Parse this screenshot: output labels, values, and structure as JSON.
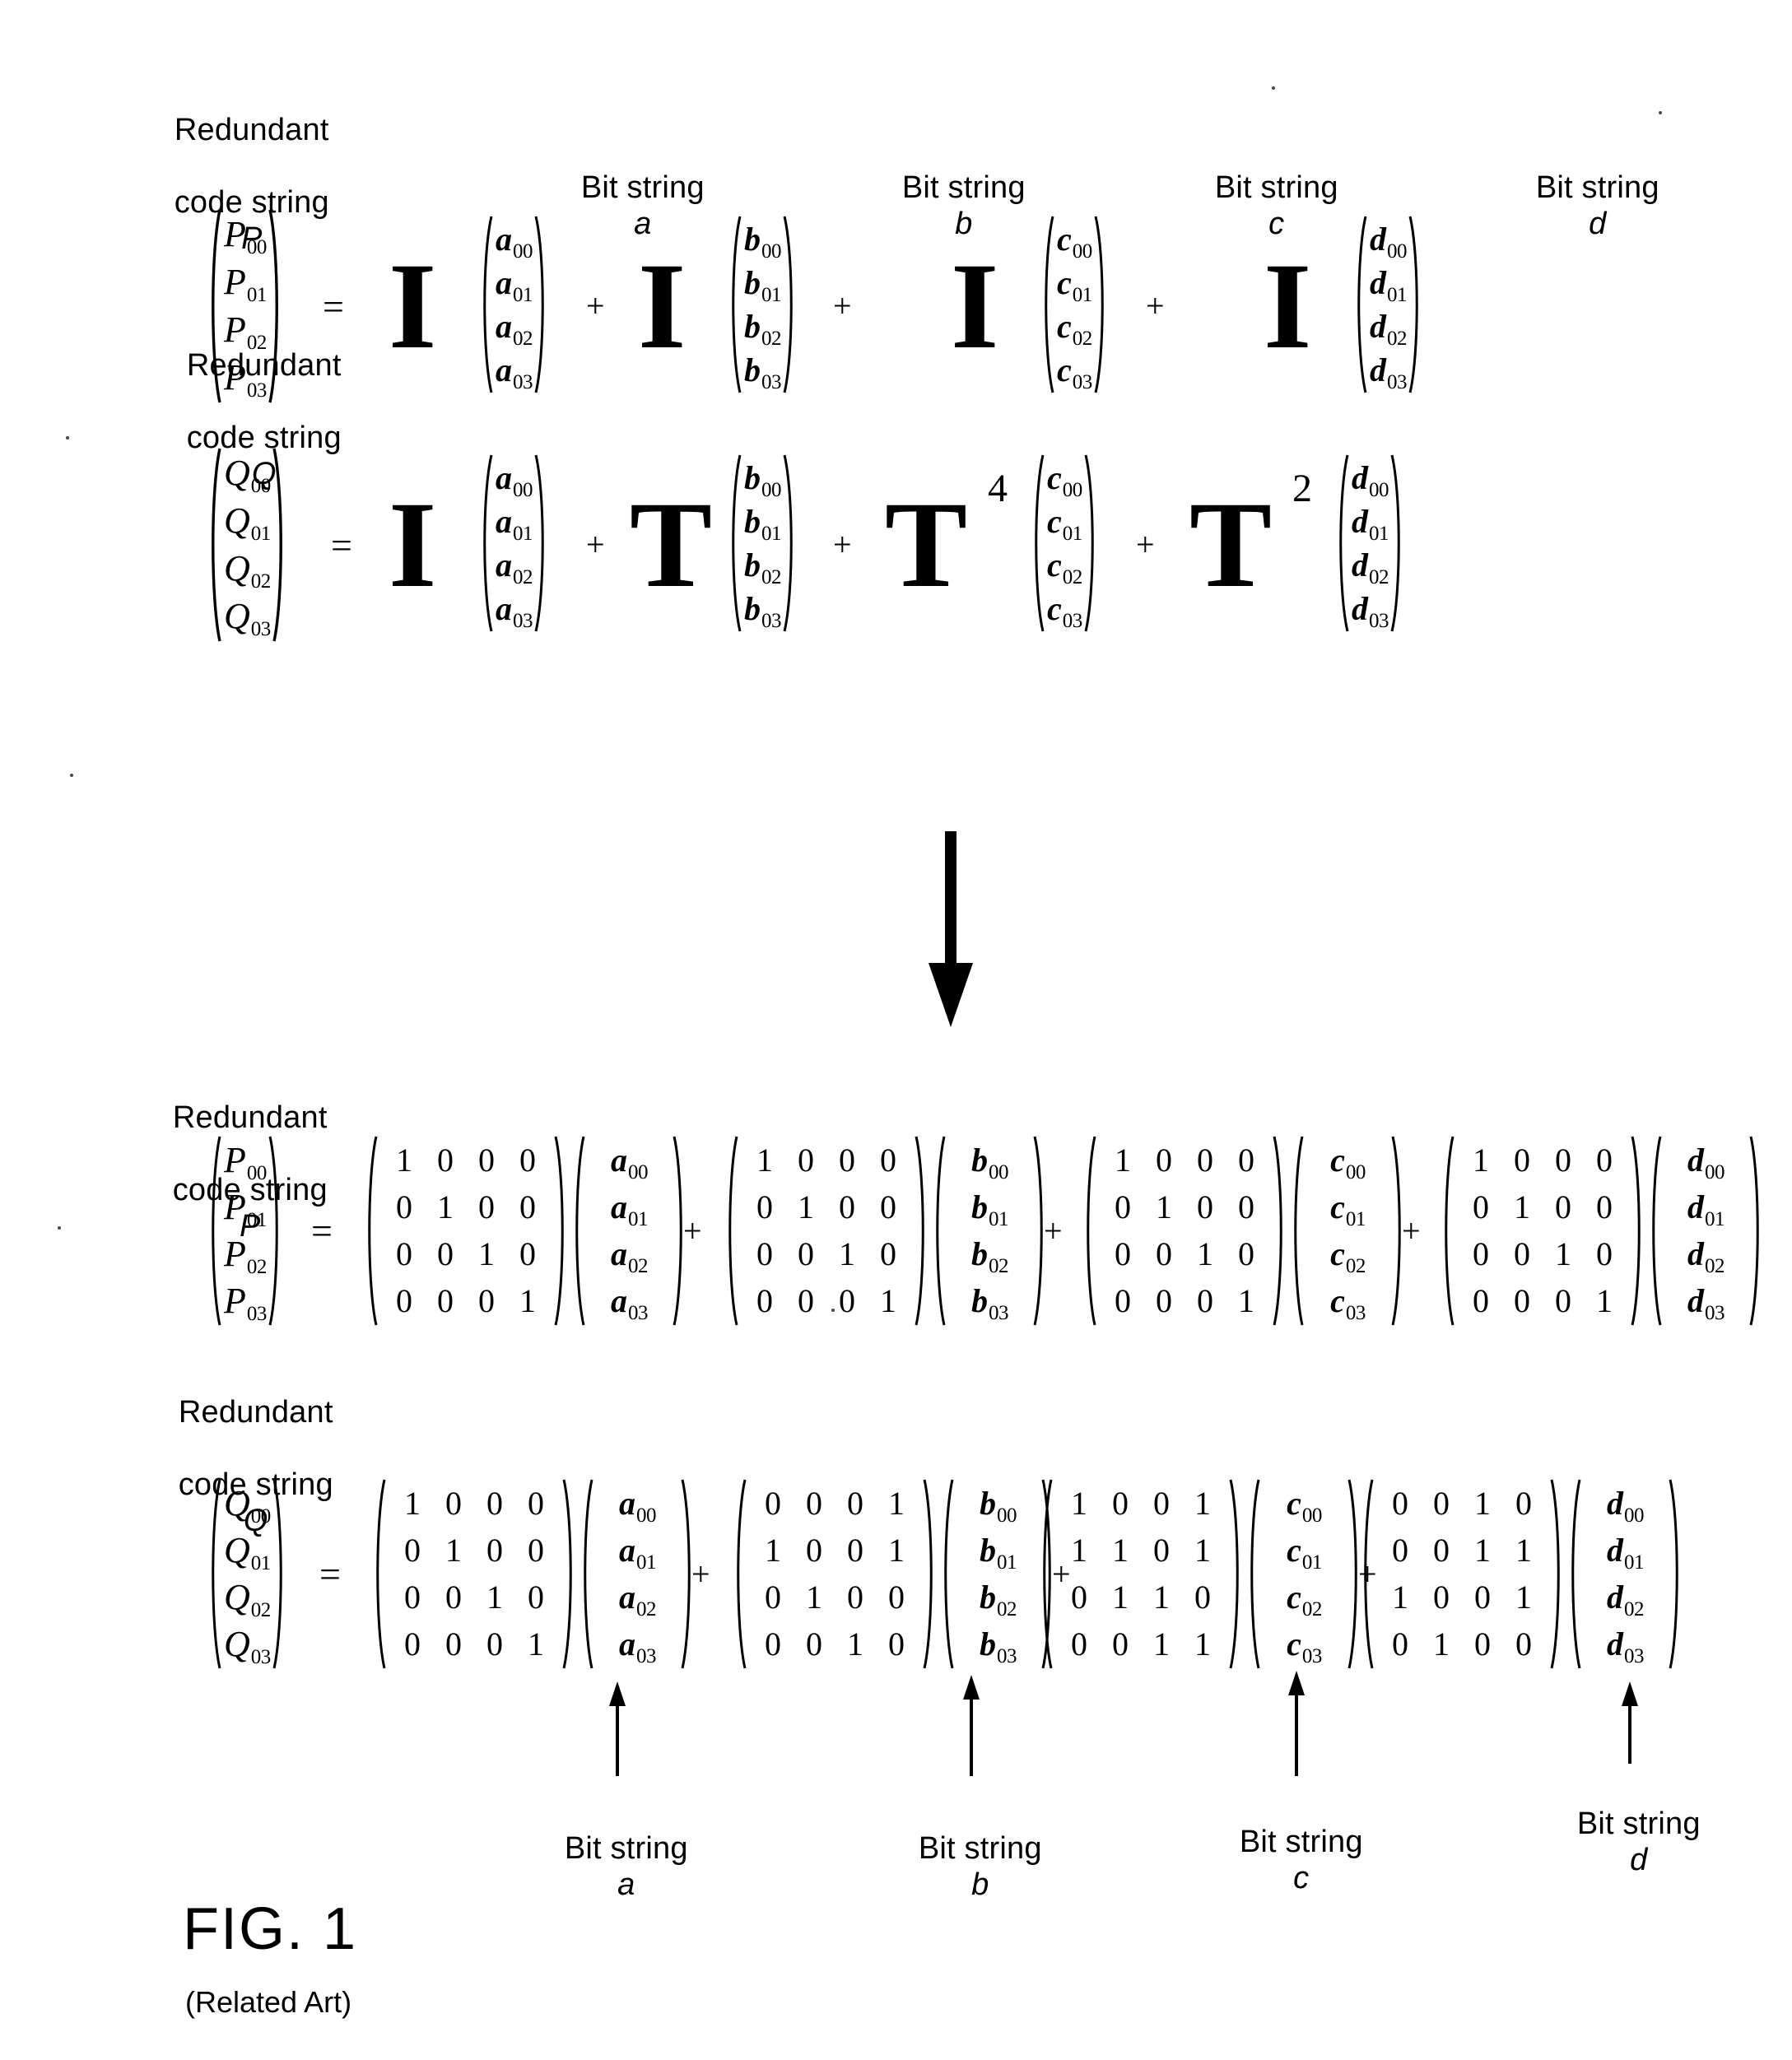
{
  "figure": {
    "title": "FIG. 1",
    "subtitle": "(Related Art)"
  },
  "labels": {
    "redundant_p": "Redundant\ncode string P",
    "redundant_q": "Redundant\ncode string Q",
    "bit_string_a": "Bit string a",
    "bit_string_b": "Bit string b",
    "bit_string_c": "Bit string c",
    "bit_string_d": "Bit string d",
    "redundant_p_line1": "Redundant",
    "redundant_p_line2": "code string",
    "redundant_p_var": "P",
    "redundant_q_var": "Q",
    "bit_string_text": "Bit string",
    "var_a": "a",
    "var_b": "b",
    "var_c": "c",
    "var_d": "d"
  },
  "operators": {
    "equals": "=",
    "plus": "+"
  },
  "symbols": {
    "identity": "I",
    "transform": "T",
    "exp_b": "",
    "exp_c": "4",
    "exp_d": "2"
  },
  "vectors": {
    "P": {
      "base": "P",
      "subs": [
        "00",
        "01",
        "02",
        "03"
      ]
    },
    "Q": {
      "base": "Q",
      "subs": [
        "00",
        "01",
        "02",
        "03"
      ]
    },
    "a": {
      "base": "a",
      "subs": [
        "00",
        "01",
        "02",
        "03"
      ]
    },
    "b": {
      "base": "b",
      "subs": [
        "00",
        "01",
        "02",
        "03"
      ]
    },
    "c": {
      "base": "c",
      "subs": [
        "00",
        "01",
        "02",
        "03"
      ]
    },
    "d": {
      "base": "d",
      "subs": [
        "00",
        "01",
        "02",
        "03"
      ]
    }
  },
  "top_equation_P": {
    "lhs": "P",
    "terms": [
      {
        "coefficient": "I",
        "exponent": "",
        "vector": "a"
      },
      {
        "coefficient": "I",
        "exponent": "",
        "vector": "b"
      },
      {
        "coefficient": "I",
        "exponent": "",
        "vector": "c"
      },
      {
        "coefficient": "I",
        "exponent": "",
        "vector": "d"
      }
    ]
  },
  "top_equation_Q": {
    "lhs": "Q",
    "terms": [
      {
        "coefficient": "I",
        "exponent": "",
        "vector": "a"
      },
      {
        "coefficient": "T",
        "exponent": "",
        "vector": "b"
      },
      {
        "coefficient": "T",
        "exponent": "4",
        "vector": "c"
      },
      {
        "coefficient": "T",
        "exponent": "2",
        "vector": "d"
      }
    ]
  },
  "bottom_equation_P": {
    "lhs": "P",
    "matrices": [
      {
        "vector": "a",
        "rows": [
          [
            1,
            0,
            0,
            0
          ],
          [
            0,
            1,
            0,
            0
          ],
          [
            0,
            0,
            1,
            0
          ],
          [
            0,
            0,
            0,
            1
          ]
        ]
      },
      {
        "vector": "b",
        "rows": [
          [
            1,
            0,
            0,
            0
          ],
          [
            0,
            1,
            0,
            0
          ],
          [
            0,
            0,
            1,
            0
          ],
          [
            0,
            0,
            0,
            1
          ]
        ]
      },
      {
        "vector": "c",
        "rows": [
          [
            1,
            0,
            0,
            0
          ],
          [
            0,
            1,
            0,
            0
          ],
          [
            0,
            0,
            1,
            0
          ],
          [
            0,
            0,
            0,
            1
          ]
        ]
      },
      {
        "vector": "d",
        "rows": [
          [
            1,
            0,
            0,
            0
          ],
          [
            0,
            1,
            0,
            0
          ],
          [
            0,
            0,
            1,
            0
          ],
          [
            0,
            0,
            0,
            1
          ]
        ]
      }
    ]
  },
  "bottom_equation_Q": {
    "lhs": "Q",
    "matrices": [
      {
        "vector": "a",
        "rows": [
          [
            1,
            0,
            0,
            0
          ],
          [
            0,
            1,
            0,
            0
          ],
          [
            0,
            0,
            1,
            0
          ],
          [
            0,
            0,
            0,
            1
          ]
        ]
      },
      {
        "vector": "b",
        "rows": [
          [
            0,
            0,
            0,
            1
          ],
          [
            1,
            0,
            0,
            1
          ],
          [
            0,
            1,
            0,
            0
          ],
          [
            0,
            0,
            1,
            0
          ]
        ]
      },
      {
        "vector": "c",
        "rows": [
          [
            1,
            0,
            0,
            1
          ],
          [
            1,
            1,
            0,
            1
          ],
          [
            0,
            1,
            1,
            0
          ],
          [
            0,
            0,
            1,
            1
          ]
        ]
      },
      {
        "vector": "d",
        "rows": [
          [
            0,
            0,
            1,
            0
          ],
          [
            0,
            0,
            1,
            1
          ],
          [
            1,
            0,
            0,
            1
          ],
          [
            0,
            1,
            0,
            0
          ]
        ]
      }
    ]
  },
  "callouts": [
    {
      "label": "Bit string a",
      "text": "Bit string",
      "var": "a"
    },
    {
      "label": "Bit string b",
      "text": "Bit string",
      "var": "b"
    },
    {
      "label": "Bit string c",
      "text": "Bit string",
      "var": "c"
    },
    {
      "label": "Bit string d",
      "text": "Bit string",
      "var": "d"
    }
  ],
  "colors": {
    "ink": "#000000",
    "background": "#ffffff"
  }
}
